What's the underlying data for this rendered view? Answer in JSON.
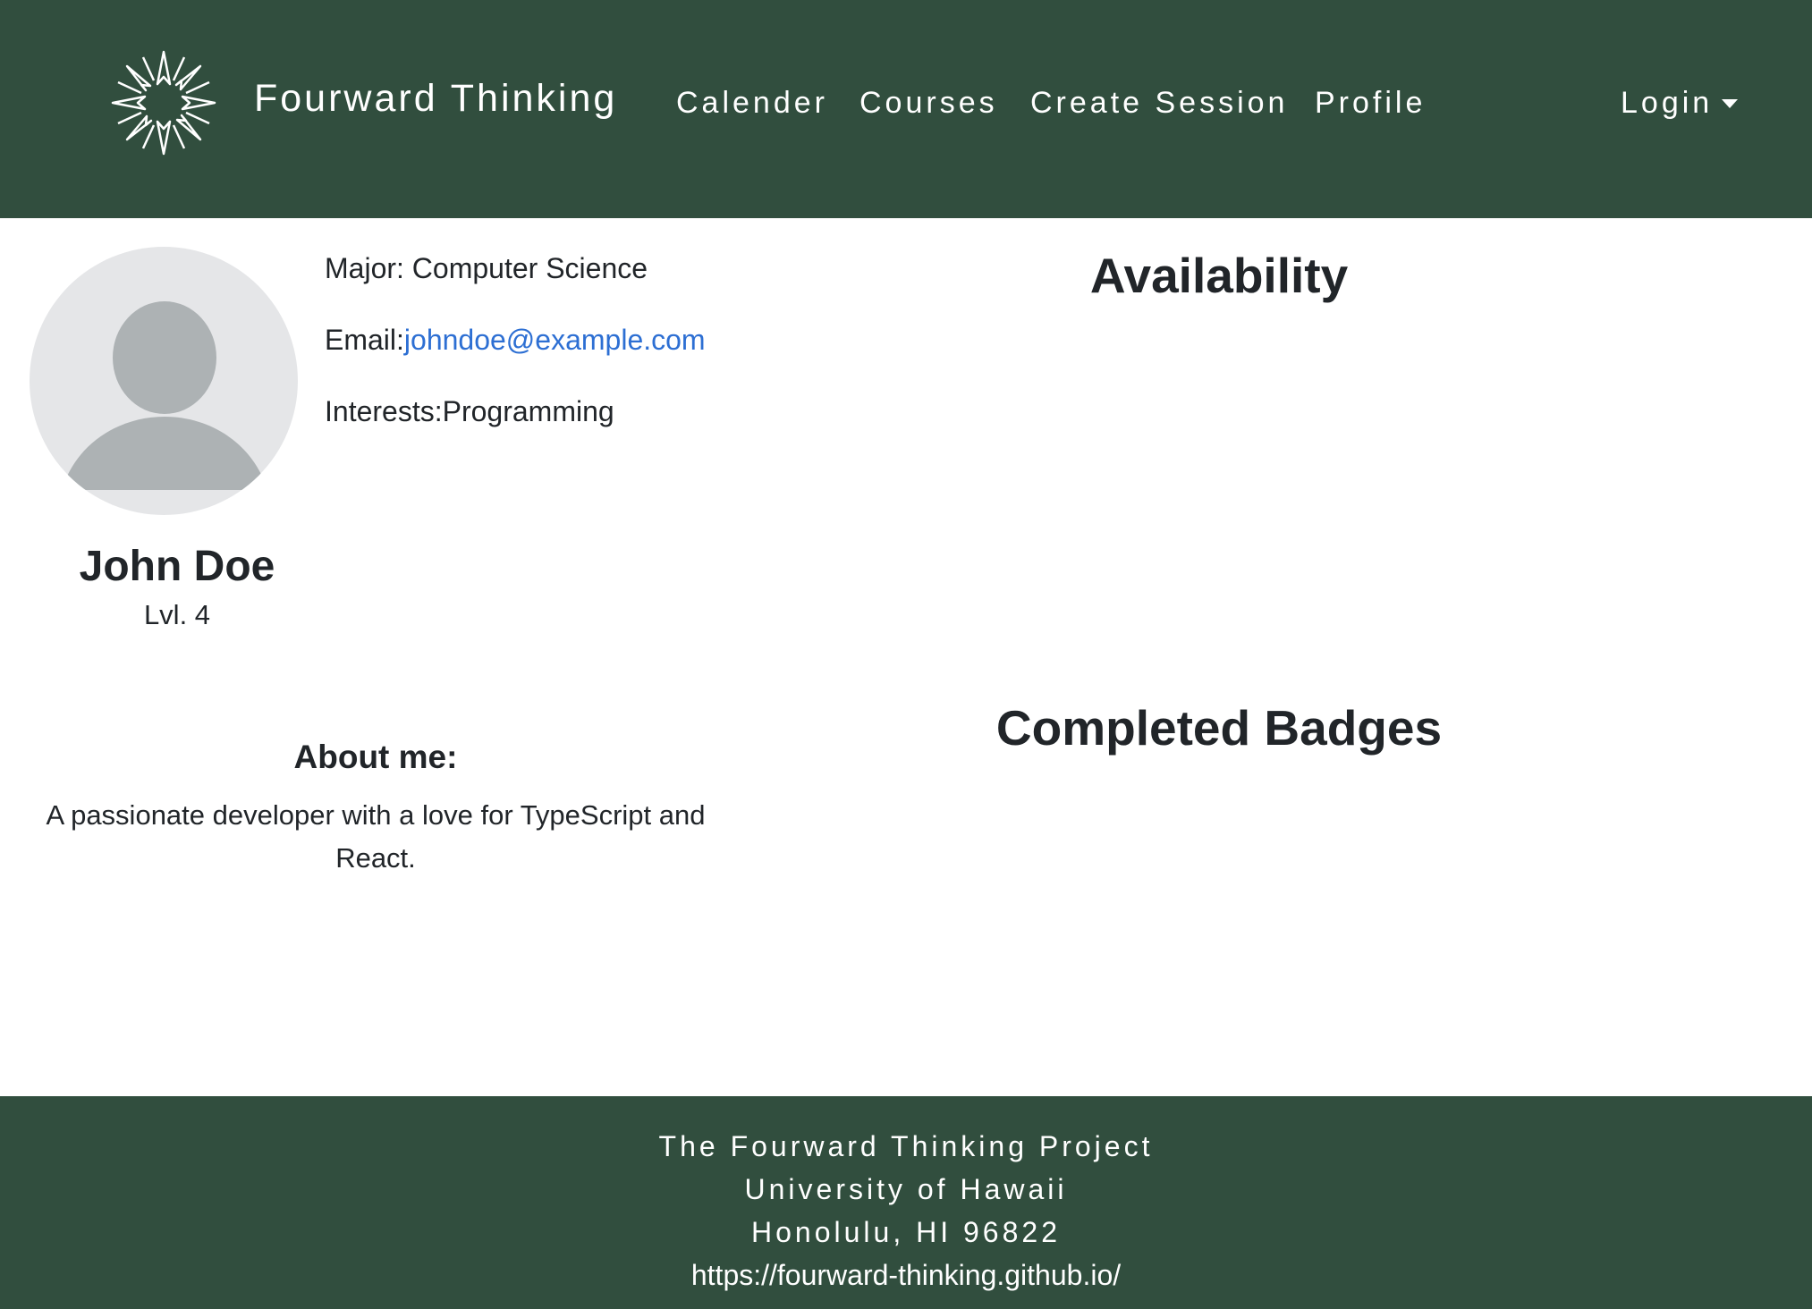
{
  "navbar": {
    "brand": "Fourward Thinking",
    "links": {
      "calendar": "Calender",
      "courses": "Courses",
      "create_session": "Create Session",
      "profile": "Profile"
    },
    "login": "Login"
  },
  "profile": {
    "name": "John Doe",
    "level": "Lvl. 4",
    "major_label": "Major: ",
    "major": "Computer Science",
    "email_label": "Email:",
    "email": "johndoe@example.com",
    "interests_label": "Interests:",
    "interests": "Programming",
    "about_title": "About me:",
    "about_text": "A passionate developer with a love for TypeScript and React."
  },
  "sections": {
    "availability": "Availability",
    "badges": "Completed Badges"
  },
  "footer": {
    "project": "The Fourward Thinking Project",
    "university": "University of Hawaii",
    "address": "Honolulu, HI 96822",
    "url": "https://fourward-thinking.github.io/"
  },
  "colors": {
    "brand_green": "#314e3e",
    "link_blue": "#2d6fd3",
    "avatar_bg": "#e5e6e8",
    "avatar_figure": "#adb2b4"
  },
  "icons": {
    "logo": "starburst-icon",
    "avatar": "user-avatar-icon",
    "login_caret": "caret-down-icon"
  }
}
